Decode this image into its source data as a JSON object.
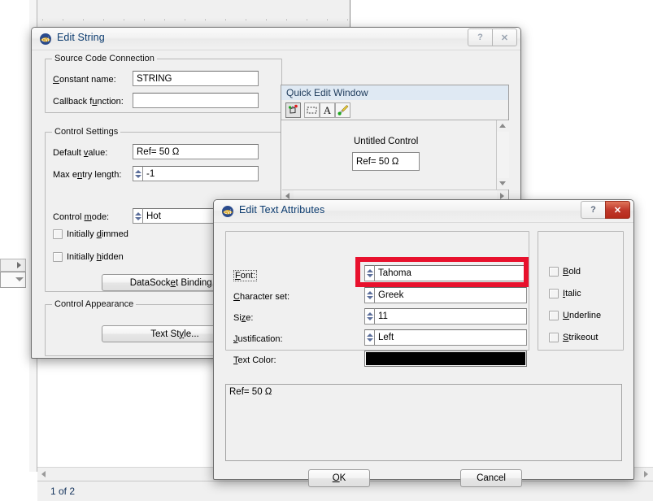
{
  "background_app": {
    "status_bar_text": "1 of 2"
  },
  "edit_string_dialog": {
    "title": "Edit String",
    "icon": "cvi-app-icon",
    "title_buttons": {
      "help": "?",
      "close": "✕"
    },
    "source_group": {
      "title": "Source Code Connection",
      "fields": [
        {
          "label": "Constant name:",
          "value": "STRING"
        },
        {
          "label": "Callback function:",
          "value": ""
        }
      ]
    },
    "control_settings_group": {
      "title": "Control Settings",
      "fields": [
        {
          "label": "Default value:",
          "value": "Ref= 50 Ω",
          "spinner": false
        },
        {
          "label": "Max entry length:",
          "value": "-1",
          "spinner": true
        },
        {
          "label": "Control mode:",
          "value": "Hot",
          "spinner": true
        }
      ],
      "checkboxes": [
        {
          "label": "Initially dimmed",
          "checked": false
        },
        {
          "label": "Initially hidden",
          "checked": false
        }
      ],
      "datasocket_button": "DataSocket Binding..."
    },
    "control_appearance_group": {
      "title": "Control Appearance",
      "text_style_button": "Text Style..."
    },
    "quick_edit_window": {
      "title": "Quick Edit Window",
      "tools": [
        "operate-hand-icon",
        "select-rect-icon",
        "text-tool-icon",
        "color-brush-icon"
      ],
      "control_label": "Untitled Control",
      "control_value": "Ref= 50 Ω"
    }
  },
  "edit_text_attributes_dialog": {
    "title": "Edit Text Attributes",
    "icon": "cvi-app-icon",
    "title_buttons": {
      "help": "?",
      "close": "✕"
    },
    "fields": [
      {
        "label": "Font:",
        "value": "Tahoma",
        "spinner": true
      },
      {
        "label": "Character set:",
        "value": "Greek",
        "spinner": true
      },
      {
        "label": "Size:",
        "value": "11",
        "spinner": true
      },
      {
        "label": "Justification:",
        "value": "Left",
        "spinner": true
      }
    ],
    "text_color": {
      "label": "Text Color:",
      "value": "#000000"
    },
    "style_checkboxes": [
      {
        "label": "Bold",
        "checked": false
      },
      {
        "label": "Italic",
        "checked": false
      },
      {
        "label": "Underline",
        "checked": false
      },
      {
        "label": "Strikeout",
        "checked": false
      }
    ],
    "preview_text": "Ref= 50 Ω",
    "buttons": {
      "ok": "OK",
      "cancel": "Cancel"
    },
    "highlight_color": "#e8112d"
  }
}
